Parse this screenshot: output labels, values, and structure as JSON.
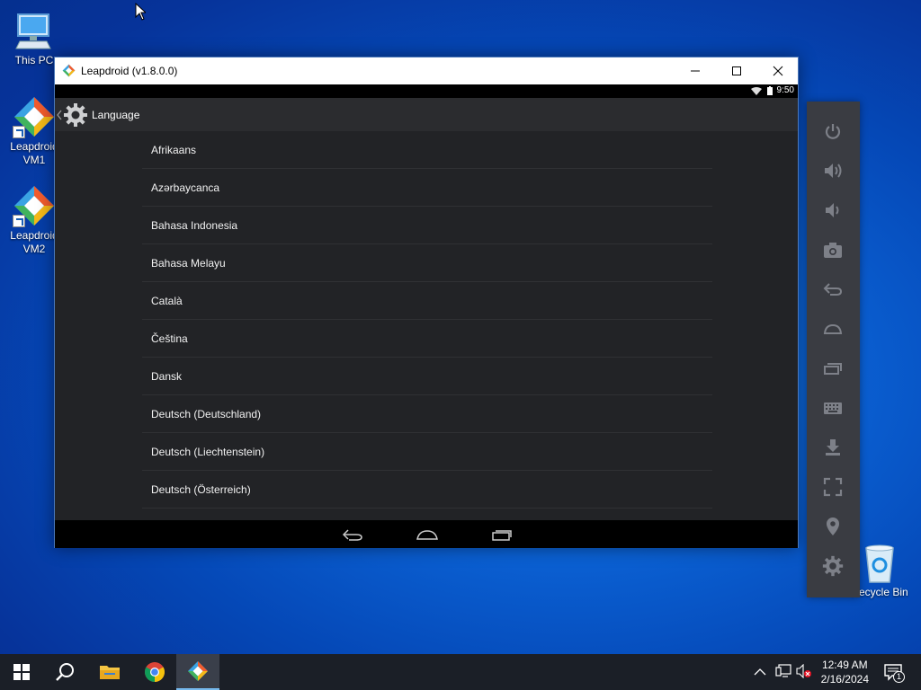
{
  "desktop": {
    "icons": [
      {
        "label": "This PC"
      },
      {
        "label": "Leapdroid VM1"
      },
      {
        "label": "Leapdroid VM2"
      },
      {
        "label": "Recycle Bin"
      }
    ]
  },
  "window": {
    "title": "Leapdroid (v1.8.0.0)",
    "controls": [
      "minimize",
      "maximize",
      "close"
    ]
  },
  "android": {
    "status_time": "9:50",
    "actionbar_title": "Language",
    "languages": [
      "Afrikaans",
      "Azərbaycanca",
      "Bahasa Indonesia",
      "Bahasa Melayu",
      "Català",
      "Čeština",
      "Dansk",
      "Deutsch (Deutschland)",
      "Deutsch (Liechtenstein)",
      "Deutsch (Österreich)"
    ],
    "nav_buttons": [
      "back-icon",
      "home-icon",
      "recents-icon"
    ]
  },
  "toolpanel": {
    "tools": [
      "power-icon",
      "volume-up-icon",
      "volume-down-icon",
      "camera-icon",
      "back-icon",
      "home-icon",
      "recents-icon",
      "keyboard-icon",
      "download-icon",
      "fullscreen-icon",
      "location-icon",
      "settings-icon"
    ]
  },
  "taskbar": {
    "time": "12:49 AM",
    "date": "2/16/2024",
    "notification_count": "1"
  },
  "colors": {
    "android_bg": "#222326",
    "actionbar": "#2b2c2f",
    "toolpanel": "#3a3c42",
    "taskbar": "#1b1f27"
  }
}
